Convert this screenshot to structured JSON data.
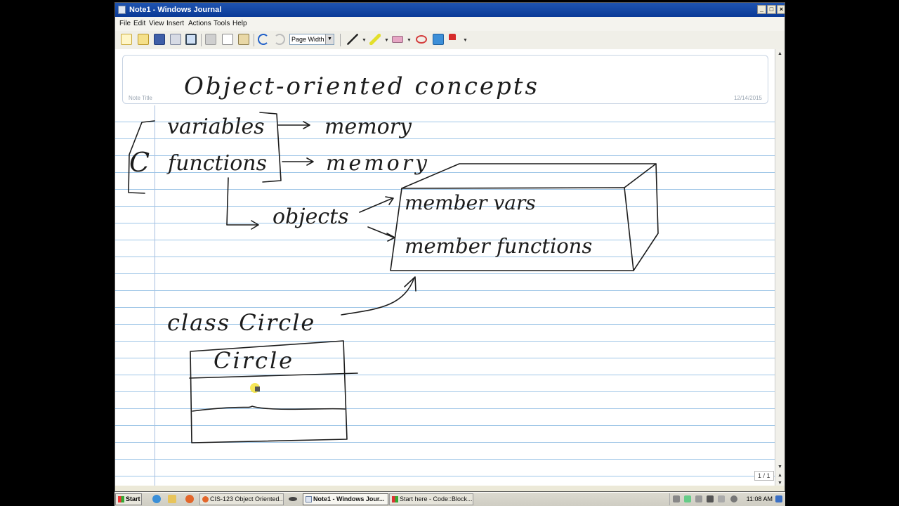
{
  "window": {
    "title": "Note1 - Windows Journal"
  },
  "menu": [
    "File",
    "Edit",
    "View",
    "Insert",
    "Actions",
    "Tools",
    "Help"
  ],
  "toolbar": {
    "zoom_value": "Page Width"
  },
  "note": {
    "title_label": "Note Title",
    "date": "12/14/2015",
    "handwritten_title": "Object-oriented concepts",
    "handwriting": {
      "variables": "variables",
      "memory1": "memory",
      "functions": "functions",
      "memory2": "memory",
      "c_letter": "C",
      "objects": "objects",
      "member_vars": "member vars",
      "member_functions": "member functions",
      "class_circle": "class Circle",
      "circle_box": "Circle"
    },
    "page_count": "1 / 1"
  },
  "taskbar": {
    "start": "Start",
    "items": [
      "CIS-123 Object Oriented...",
      "Note1 - Windows Jour...",
      "Start here - Code::Block..."
    ],
    "clock": "11:08 AM"
  }
}
